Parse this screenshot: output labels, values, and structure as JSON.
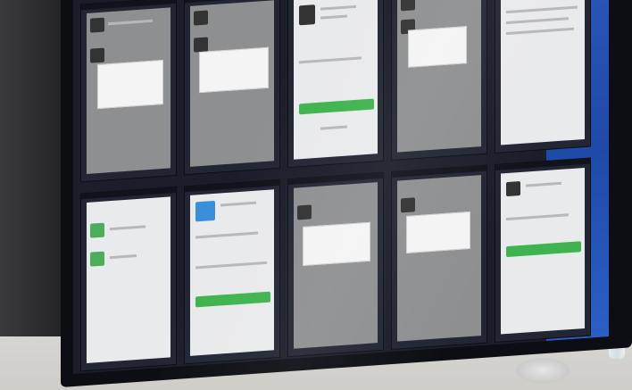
{
  "scene": {
    "colors": {
      "bezel": "#0c0e14",
      "screen_bg": "#1b1e2a",
      "desktop_blue": "#2a56b8",
      "phone_gray": "#8e8f91",
      "phone_light": "#e9eaec",
      "accent_green": "#3fb34f",
      "accent_blue": "#3b8fd8"
    }
  },
  "tiles": [
    {
      "theme": "gray",
      "content": "dialog"
    },
    {
      "theme": "gray",
      "content": "dialog"
    },
    {
      "theme": "light",
      "content": "profile-green-button"
    },
    {
      "theme": "gray",
      "content": "dialog"
    },
    {
      "theme": "light",
      "content": "text-list"
    },
    {
      "theme": "light",
      "content": "list-green-icons"
    },
    {
      "theme": "light",
      "content": "profile-blue-green-button"
    },
    {
      "theme": "gray",
      "content": "dialog"
    },
    {
      "theme": "gray",
      "content": "dialog"
    },
    {
      "theme": "light",
      "content": "profile-green-button"
    }
  ]
}
